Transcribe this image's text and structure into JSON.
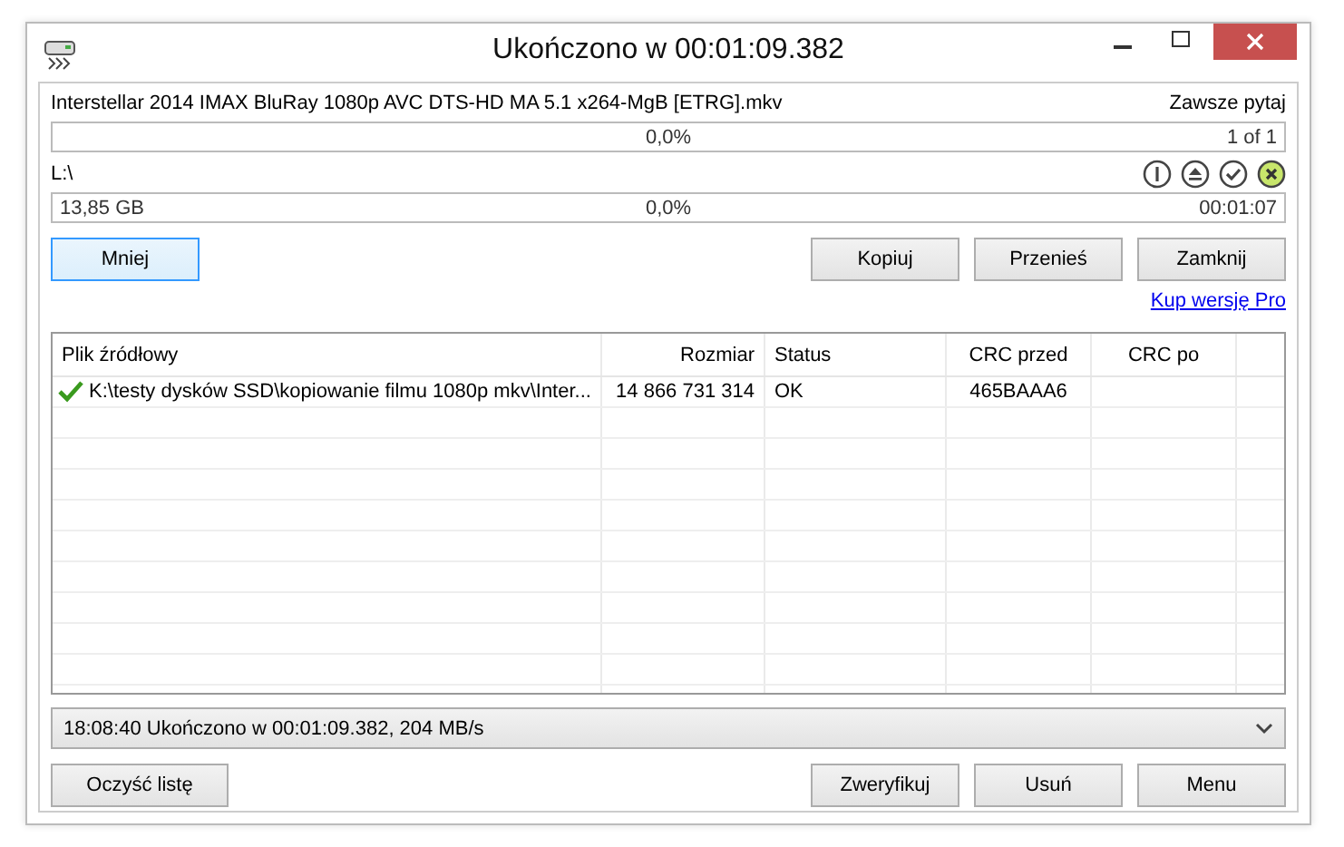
{
  "window": {
    "title": "Ukończono w 00:01:09.382"
  },
  "source": {
    "filename": "Interstellar 2014 IMAX BluRay 1080p AVC DTS-HD MA 5.1 x264-MgB [ETRG].mkv",
    "mode": "Zawsze pytaj"
  },
  "file_progress": {
    "level": 0,
    "percent": "0,0%",
    "count": "1 of 1"
  },
  "destination": {
    "path": "L:\\"
  },
  "total_progress": {
    "level": 0,
    "size": "13,85 GB",
    "percent": "0,0%",
    "time": "00:01:07"
  },
  "buttons_top": [
    {
      "label": "Mniej",
      "focused": true
    },
    {
      "label": "Kopiuj",
      "focused": false
    },
    {
      "label": "Przenieś",
      "focused": false
    },
    {
      "label": "Zamknij",
      "focused": false
    }
  ],
  "link": "Kup wersję Pro",
  "table": {
    "columns": [
      {
        "label": "Plik źródłowy"
      },
      {
        "label": "Rozmiar"
      },
      {
        "label": "Status"
      },
      {
        "label": "CRC przed"
      },
      {
        "label": "CRC po"
      }
    ],
    "rows": [
      {
        "ok": true,
        "cells": [
          "K:\\testy dysków SSD\\kopiowanie filmu 1080p mkv\\Inter...",
          "14 866 731 314",
          "OK",
          "465BAAA6",
          ""
        ]
      }
    ]
  },
  "log": {
    "value": "18:08:40 Ukończono w 00:01:09.382, 204 MB/s"
  },
  "buttons_bottom": [
    "Oczyść listę",
    "Zweryfikuj",
    "Usuń",
    "Menu"
  ]
}
